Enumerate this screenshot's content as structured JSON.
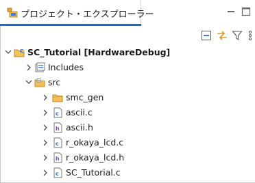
{
  "view": {
    "title": "プロジェクト・エクスプローラー"
  },
  "toolbar": {
    "buttons": [
      "collapse-all",
      "link-with-editor",
      "filter",
      "view-menu"
    ]
  },
  "tree": [
    {
      "label": "SC_Tutorial [HardwareDebug]",
      "icon": "c-project-icon",
      "level": 0,
      "expanded": true
    },
    {
      "label": "Includes",
      "icon": "includes-icon",
      "level": 1,
      "expanded": false
    },
    {
      "label": "src",
      "icon": "source-folder-icon",
      "level": 1,
      "expanded": true
    },
    {
      "label": "smc_gen",
      "icon": "folder-icon",
      "level": 2,
      "expanded": false
    },
    {
      "label": "ascii.c",
      "icon": "c-file-icon",
      "level": 2,
      "expanded": false
    },
    {
      "label": "ascii.h",
      "icon": "h-file-icon",
      "level": 2,
      "expanded": false
    },
    {
      "label": "r_okaya_lcd.c",
      "icon": "c-file-icon",
      "level": 2,
      "expanded": false
    },
    {
      "label": "r_okaya_lcd.h",
      "icon": "h-file-icon",
      "level": 2,
      "expanded": false
    },
    {
      "label": "SC_Tutorial.c",
      "icon": "c-file-icon",
      "level": 2,
      "expanded": false
    }
  ]
}
